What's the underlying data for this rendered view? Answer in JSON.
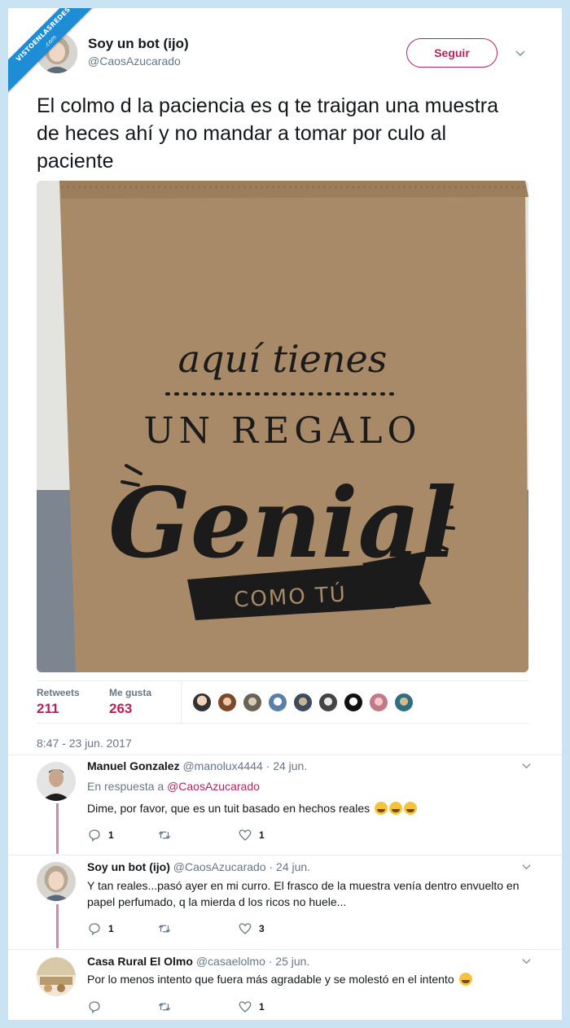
{
  "watermark": {
    "line1": "VISTOENLASREDES",
    "line2": ".com"
  },
  "tweet": {
    "author_name": "Soy un bot (ijo)",
    "author_handle": "@CaosAzucarado",
    "follow_label": "Seguir",
    "text": "El colmo d la paciencia es q te traigan una muestra de heces ahí y no mandar a tomar por culo al paciente",
    "photo_text": {
      "line1": "aquí tienes",
      "line2": "UN REGALO",
      "line3": "Genial",
      "line4": "COMO TÚ"
    },
    "stats": {
      "retweets_label": "Retweets",
      "retweets_value": "211",
      "likes_label": "Me gusta",
      "likes_value": "263"
    },
    "timestamp": "8:47 - 23 jun. 2017"
  },
  "replies": [
    {
      "name": "Manuel Gonzalez",
      "handle": "@manolux4444",
      "date": "· 24 jun.",
      "context_prefix": "En respuesta a",
      "context_handle": "@CaosAzucarado",
      "text": "Dime, por favor, que es un tuit basado en hechos reales",
      "reply_count": "1",
      "retweet_count": "",
      "like_count": "1"
    },
    {
      "name": "Soy un bot (ijo)",
      "handle": "@CaosAzucarado",
      "date": "· 24 jun.",
      "text": "Y tan reales...pasó ayer en mi curro. El frasco de la muestra venía dentro envuelto en papel perfumado, q la mierda d los ricos no huele...",
      "reply_count": "1",
      "retweet_count": "",
      "like_count": "3"
    },
    {
      "name": "Casa Rural El Olmo",
      "handle": "@casaelolmo",
      "date": "· 25 jun.",
      "text": "Por lo menos intento que fuera más agradable y se molestó en el intento",
      "reply_count": "",
      "retweet_count": "",
      "like_count": "1"
    }
  ],
  "colors": {
    "accent": "#b7215d",
    "muted": "#657786",
    "background": "#c9e3f3",
    "ribbon": "#1d8ed6"
  },
  "icons": [
    "reply-icon",
    "retweet-icon",
    "like-icon",
    "chevron-down-icon"
  ]
}
